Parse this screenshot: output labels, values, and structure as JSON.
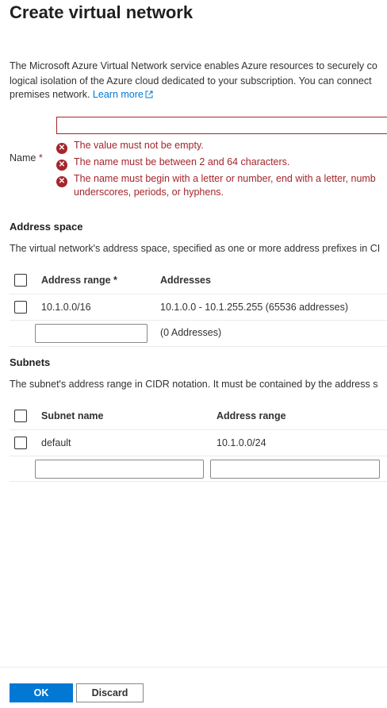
{
  "page": {
    "title": "Create virtual network",
    "description_lines": [
      "The Microsoft Azure Virtual Network service enables Azure resources to securely co",
      "logical isolation of the Azure cloud dedicated to your subscription. You can connect",
      "premises network."
    ],
    "learn_more": "Learn more"
  },
  "name_field": {
    "label": "Name",
    "required_mark": "*",
    "value": "",
    "errors": [
      "The value must not be empty.",
      "The name must be between 2 and 64 characters.",
      "The name must begin with a letter or number, end with a letter, numb",
      "underscores, periods, or hyphens."
    ]
  },
  "address_space": {
    "heading": "Address space",
    "description": "The virtual network's address space, specified as one or more address prefixes in CI",
    "columns": [
      "Address range *",
      "Addresses"
    ],
    "rows": [
      {
        "range": "10.1.0.0/16",
        "addresses": "10.1.0.0 - 10.1.255.255 (65536 addresses)"
      }
    ],
    "new_row_addresses": "(0 Addresses)"
  },
  "subnets": {
    "heading": "Subnets",
    "description": "The subnet's address range in CIDR notation. It must be contained by the address s",
    "columns": [
      "Subnet name",
      "Address range"
    ],
    "rows": [
      {
        "name": "default",
        "range": "10.1.0.0/24"
      }
    ]
  },
  "footer": {
    "ok_label": "OK",
    "discard_label": "Discard"
  },
  "colors": {
    "accent": "#0078d4",
    "error": "#a4262c"
  }
}
